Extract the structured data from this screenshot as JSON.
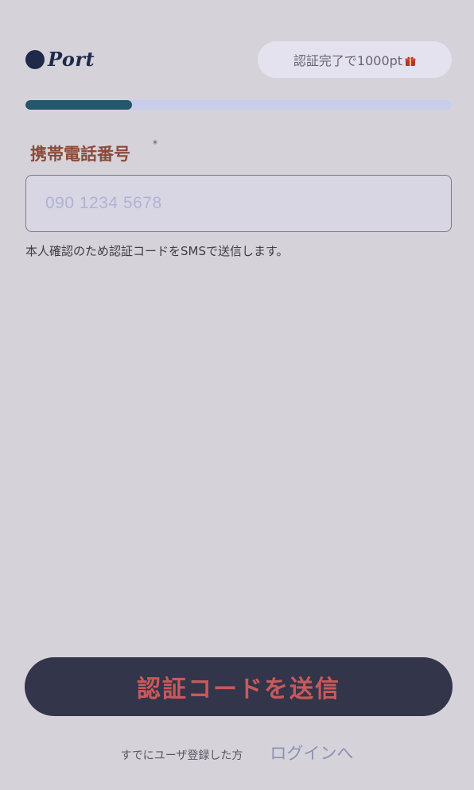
{
  "header": {
    "logo_text": "Port",
    "reward_text": "認証完了で1000pt"
  },
  "colors": {
    "brand": "#1f2a4a",
    "progress_track": "#c8cdeb",
    "progress_fill": "#25566b",
    "button_bg": "#33354a"
  },
  "progress": {
    "value_percent": 25
  },
  "form": {
    "phone_label": "携帯電話番号",
    "required_mark": "*",
    "phone_value": "",
    "phone_placeholder": "090 1234 5678",
    "helper_text": "本人確認のため認証コードをSMSで送信します。"
  },
  "actions": {
    "submit_label": "認証コードを送信"
  },
  "footer": {
    "registered_text": "すでにユーザ登録した方",
    "login_link": "ログインへ"
  },
  "icons": [
    "logo-dot-icon",
    "gift-icon"
  ]
}
